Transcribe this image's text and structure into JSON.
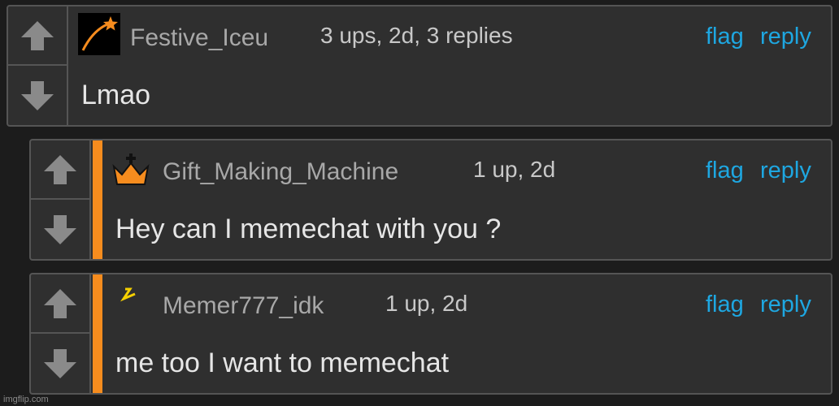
{
  "comments": [
    {
      "username": "Festive_Iceu",
      "meta": "3 ups, 2d, 3 replies",
      "text": "Lmao",
      "flag": "flag",
      "reply": "reply"
    },
    {
      "username": "Gift_Making_Machine",
      "meta": "1 up, 2d",
      "text": "Hey can I memechat with you ?",
      "flag": "flag",
      "reply": "reply"
    },
    {
      "username": "Memer777_idk",
      "meta": "1 up, 2d",
      "text": "me too I want to memechat",
      "flag": "flag",
      "reply": "reply"
    }
  ],
  "watermark": "imgflip.com",
  "colors": {
    "accent": "#f68c1e",
    "link": "#1ea7e1"
  },
  "icons": {
    "upvote": "arrow-up-icon",
    "downvote": "arrow-down-icon",
    "avatar_1": "shooting-star-icon",
    "avatar_2": "crown-icon",
    "avatar_3": "lightning-icon"
  }
}
